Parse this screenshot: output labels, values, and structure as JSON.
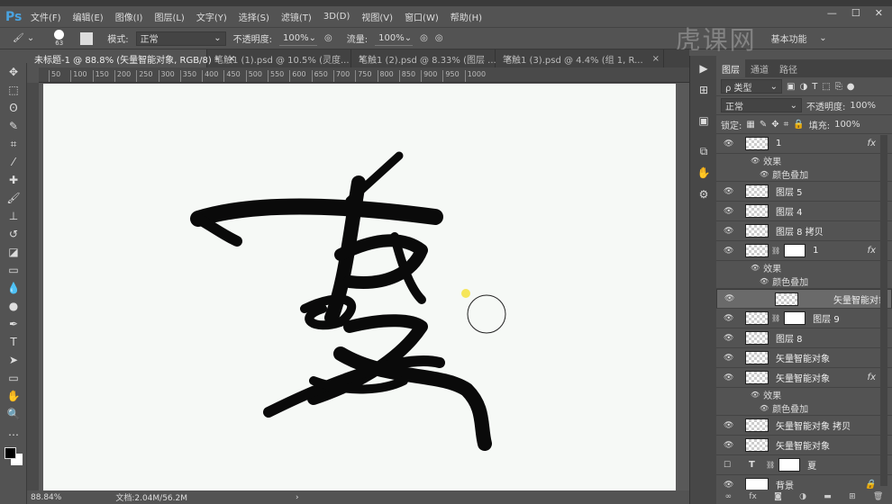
{
  "app": {
    "logo": "Ps"
  },
  "menu": [
    "文件(F)",
    "编辑(E)",
    "图像(I)",
    "图层(L)",
    "文字(Y)",
    "选择(S)",
    "滤镜(T)",
    "3D(D)",
    "视图(V)",
    "窗口(W)",
    "帮助(H)"
  ],
  "window_buttons": [
    "—",
    "☐",
    "✕"
  ],
  "options": {
    "brush_size": "63",
    "mode_label": "模式:",
    "mode_value": "正常",
    "opacity_label": "不透明度:",
    "opacity_value": "100%",
    "flow_label": "流量:",
    "flow_value": "100%",
    "workspace": "基本功能"
  },
  "tabs": [
    {
      "label": "未标题-1 @ 88.8% (矢量智能对象, RGB/8) *",
      "active": true
    },
    {
      "label": "笔触1 (1).psd @ 10.5% (灵度..."
    },
    {
      "label": "笔触1 (2).psd @ 8.33% (图层 ..."
    },
    {
      "label": "笔触1 (3).psd @ 4.4% (组 1, R..."
    }
  ],
  "ruler": [
    "50",
    "100",
    "150",
    "200",
    "250",
    "300",
    "350",
    "400",
    "450",
    "500",
    "550",
    "600",
    "650",
    "700",
    "750",
    "800",
    "850",
    "900",
    "950",
    "1000"
  ],
  "status": {
    "zoom": "88.84%",
    "doc": "文档:2.04M/56.2M"
  },
  "panel": {
    "tabs": [
      "图层",
      "通道",
      "路径"
    ],
    "filter": "ρ 类型",
    "blend": "正常",
    "opacity_label": "不透明度:",
    "opacity": "100%",
    "lock_label": "锁定:",
    "fill_label": "填充:",
    "fill": "100%",
    "layers": [
      {
        "name": "1",
        "fx": "fx",
        "effects": [
          "效果",
          "颜色叠加"
        ]
      },
      {
        "name": "图层 5"
      },
      {
        "name": "图层 4"
      },
      {
        "name": "图层 8 拷贝"
      },
      {
        "name": "1",
        "mask": true,
        "fx": "fx",
        "effects": [
          "效果",
          "颜色叠加"
        ]
      },
      {
        "name": "矢量智能对象",
        "selected": true
      },
      {
        "name": "图层 9",
        "mask": true
      },
      {
        "name": "图层 8"
      },
      {
        "name": "矢量智能对象"
      },
      {
        "name": "矢量智能对象",
        "fx": "fx",
        "effects": [
          "效果",
          "颜色叠加"
        ]
      },
      {
        "name": "矢量智能对象 拷贝"
      },
      {
        "name": "矢量智能对象"
      },
      {
        "name": "夏",
        "text": true,
        "mask": true,
        "hidden": true
      },
      {
        "name": "背景",
        "bg": true
      }
    ]
  },
  "watermark": "虎课网"
}
